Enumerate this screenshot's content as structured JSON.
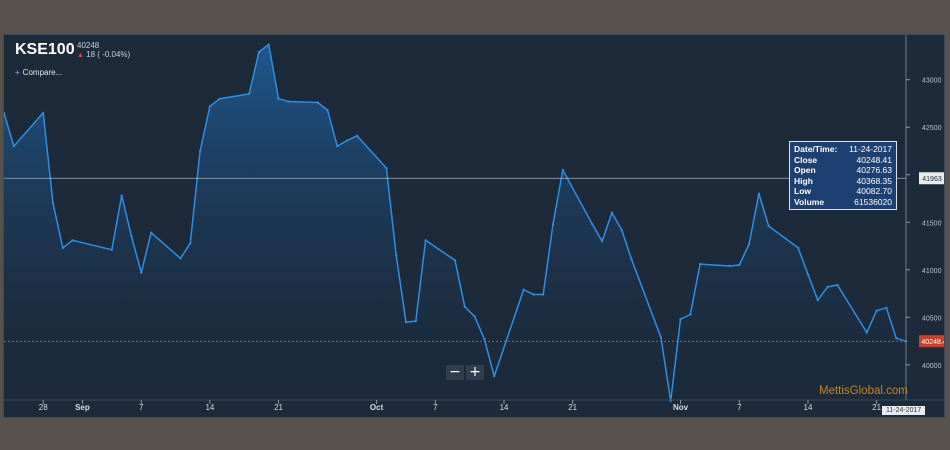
{
  "header": {
    "symbol": "KSE100",
    "last_value": "40248",
    "change_arrow": "▲",
    "change": "18 ( -0.04%)",
    "compare_label": "Compare..."
  },
  "zoom": {
    "minus": "−",
    "plus": "+"
  },
  "tooltip": {
    "rows": [
      {
        "label": "Date/Time:",
        "value": "11-24-2017"
      },
      {
        "label": "Close",
        "value": "40248.41"
      },
      {
        "label": "Open",
        "value": "40276.63"
      },
      {
        "label": "High",
        "value": "40368.35"
      },
      {
        "label": "Low",
        "value": "40082.70"
      },
      {
        "label": "Volume",
        "value": "61536020"
      }
    ]
  },
  "watermark": "MettisGlobal.com",
  "date_badge": "11-24-2017",
  "colors": {
    "background": "#1c2a3a",
    "line": "#2f8ee0",
    "fill_top": "#1f5f9e",
    "tooltip_bg": "#1d3f72",
    "last_price_badge": "#c9412b"
  },
  "chart_data": {
    "type": "area",
    "x": [
      "2017-08-24",
      "2017-08-25",
      "2017-08-28",
      "2017-08-29",
      "2017-08-30",
      "2017-08-31",
      "2017-09-04",
      "2017-09-05",
      "2017-09-06",
      "2017-09-07",
      "2017-09-08",
      "2017-09-11",
      "2017-09-12",
      "2017-09-13",
      "2017-09-14",
      "2017-09-15",
      "2017-09-18",
      "2017-09-19",
      "2017-09-20",
      "2017-09-21",
      "2017-09-22",
      "2017-09-25",
      "2017-09-26",
      "2017-09-27",
      "2017-09-28",
      "2017-09-29",
      "2017-10-02",
      "2017-10-03",
      "2017-10-04",
      "2017-10-05",
      "2017-10-06",
      "2017-10-09",
      "2017-10-10",
      "2017-10-11",
      "2017-10-12",
      "2017-10-13",
      "2017-10-16",
      "2017-10-17",
      "2017-10-18",
      "2017-10-19",
      "2017-10-20",
      "2017-10-23",
      "2017-10-24",
      "2017-10-25",
      "2017-10-26",
      "2017-10-27",
      "2017-10-30",
      "2017-10-31",
      "2017-11-01",
      "2017-11-02",
      "2017-11-03",
      "2017-11-06",
      "2017-11-07",
      "2017-11-08",
      "2017-11-09",
      "2017-11-10",
      "2017-11-13",
      "2017-11-14",
      "2017-11-15",
      "2017-11-16",
      "2017-11-17",
      "2017-11-20",
      "2017-11-21",
      "2017-11-22",
      "2017-11-23",
      "2017-11-24"
    ],
    "values": [
      42650,
      42300,
      42650,
      41700,
      41230,
      41310,
      41210,
      41780,
      41350,
      40970,
      41390,
      41120,
      41280,
      42250,
      42720,
      42800,
      42850,
      43290,
      43370,
      42800,
      42770,
      42760,
      42680,
      42300,
      42360,
      42410,
      42070,
      41150,
      40450,
      40460,
      41310,
      41100,
      40610,
      40510,
      40270,
      39880,
      40790,
      40740,
      40740,
      41480,
      42050,
      41480,
      41300,
      41600,
      41420,
      41110,
      40290,
      39620,
      40480,
      40530,
      41060,
      41040,
      41050,
      41270,
      41800,
      41460,
      41230,
      40950,
      40680,
      40820,
      40840,
      40340,
      40570,
      40600,
      40280,
      40248
    ],
    "tick_labels_x": [
      "28",
      "Sep",
      "7",
      "14",
      "21",
      "Oct",
      "7",
      "14",
      "21",
      "Nov",
      "7",
      "14",
      "21"
    ],
    "tick_dates_x": [
      "2017-08-28",
      "2017-09-01",
      "2017-09-07",
      "2017-09-14",
      "2017-09-21",
      "2017-10-01",
      "2017-10-07",
      "2017-10-14",
      "2017-10-21",
      "2017-11-01",
      "2017-11-07",
      "2017-11-14",
      "2017-11-21"
    ],
    "y_ticks": [
      40000,
      40500,
      41000,
      41500,
      42000,
      42500,
      43000
    ],
    "ylim": [
      39630,
      43470
    ],
    "crosshair_y": 41963,
    "crosshair_label": "41963",
    "last_price": 40248.41,
    "last_price_label": "40248.41",
    "grid": false
  }
}
